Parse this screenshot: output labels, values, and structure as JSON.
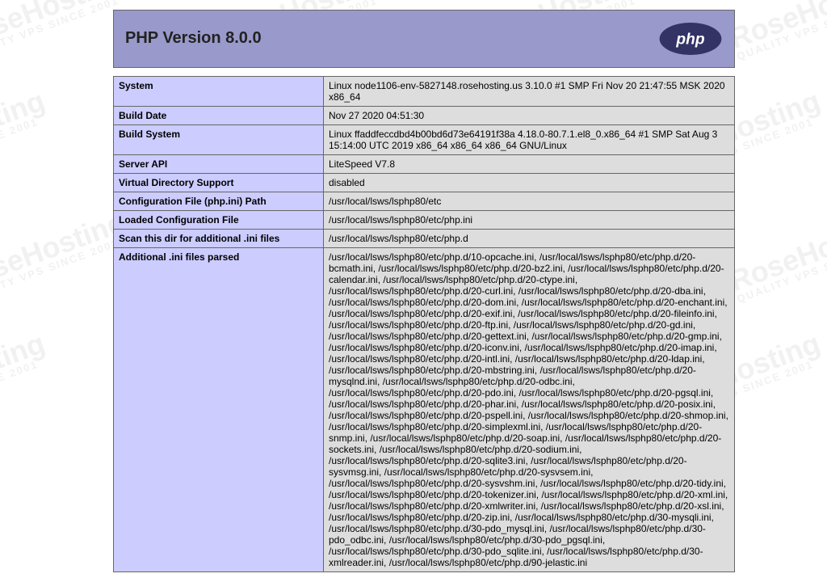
{
  "header": {
    "title": "PHP Version 8.0.0",
    "logo_text": "php"
  },
  "watermark": {
    "brand": "RoseHosting",
    "tagline": "QUALITY VPS SINCE 2001"
  },
  "rows": [
    {
      "label": "System",
      "value": "Linux node1106-env-5827148.rosehosting.us 3.10.0 #1 SMP Fri Nov 20 21:47:55 MSK 2020 x86_64"
    },
    {
      "label": "Build Date",
      "value": "Nov 27 2020 04:51:30"
    },
    {
      "label": "Build System",
      "value": "Linux ffaddfeccdbd4b00bd6d73e64191f38a 4.18.0-80.7.1.el8_0.x86_64 #1 SMP Sat Aug 3 15:14:00 UTC 2019 x86_64 x86_64 x86_64 GNU/Linux"
    },
    {
      "label": "Server API",
      "value": "LiteSpeed V7.8"
    },
    {
      "label": "Virtual Directory Support",
      "value": "disabled"
    },
    {
      "label": "Configuration File (php.ini) Path",
      "value": "/usr/local/lsws/lsphp80/etc"
    },
    {
      "label": "Loaded Configuration File",
      "value": "/usr/local/lsws/lsphp80/etc/php.ini"
    },
    {
      "label": "Scan this dir for additional .ini files",
      "value": "/usr/local/lsws/lsphp80/etc/php.d"
    },
    {
      "label": "Additional .ini files parsed",
      "value": "/usr/local/lsws/lsphp80/etc/php.d/10-opcache.ini, /usr/local/lsws/lsphp80/etc/php.d/20-bcmath.ini, /usr/local/lsws/lsphp80/etc/php.d/20-bz2.ini, /usr/local/lsws/lsphp80/etc/php.d/20-calendar.ini, /usr/local/lsws/lsphp80/etc/php.d/20-ctype.ini, /usr/local/lsws/lsphp80/etc/php.d/20-curl.ini, /usr/local/lsws/lsphp80/etc/php.d/20-dba.ini, /usr/local/lsws/lsphp80/etc/php.d/20-dom.ini, /usr/local/lsws/lsphp80/etc/php.d/20-enchant.ini, /usr/local/lsws/lsphp80/etc/php.d/20-exif.ini, /usr/local/lsws/lsphp80/etc/php.d/20-fileinfo.ini, /usr/local/lsws/lsphp80/etc/php.d/20-ftp.ini, /usr/local/lsws/lsphp80/etc/php.d/20-gd.ini, /usr/local/lsws/lsphp80/etc/php.d/20-gettext.ini, /usr/local/lsws/lsphp80/etc/php.d/20-gmp.ini, /usr/local/lsws/lsphp80/etc/php.d/20-iconv.ini, /usr/local/lsws/lsphp80/etc/php.d/20-imap.ini, /usr/local/lsws/lsphp80/etc/php.d/20-intl.ini, /usr/local/lsws/lsphp80/etc/php.d/20-ldap.ini, /usr/local/lsws/lsphp80/etc/php.d/20-mbstring.ini, /usr/local/lsws/lsphp80/etc/php.d/20-mysqlnd.ini, /usr/local/lsws/lsphp80/etc/php.d/20-odbc.ini, /usr/local/lsws/lsphp80/etc/php.d/20-pdo.ini, /usr/local/lsws/lsphp80/etc/php.d/20-pgsql.ini, /usr/local/lsws/lsphp80/etc/php.d/20-phar.ini, /usr/local/lsws/lsphp80/etc/php.d/20-posix.ini, /usr/local/lsws/lsphp80/etc/php.d/20-pspell.ini, /usr/local/lsws/lsphp80/etc/php.d/20-shmop.ini, /usr/local/lsws/lsphp80/etc/php.d/20-simplexml.ini, /usr/local/lsws/lsphp80/etc/php.d/20-snmp.ini, /usr/local/lsws/lsphp80/etc/php.d/20-soap.ini, /usr/local/lsws/lsphp80/etc/php.d/20-sockets.ini, /usr/local/lsws/lsphp80/etc/php.d/20-sodium.ini, /usr/local/lsws/lsphp80/etc/php.d/20-sqlite3.ini, /usr/local/lsws/lsphp80/etc/php.d/20-sysvmsg.ini, /usr/local/lsws/lsphp80/etc/php.d/20-sysvsem.ini, /usr/local/lsws/lsphp80/etc/php.d/20-sysvshm.ini, /usr/local/lsws/lsphp80/etc/php.d/20-tidy.ini, /usr/local/lsws/lsphp80/etc/php.d/20-tokenizer.ini, /usr/local/lsws/lsphp80/etc/php.d/20-xml.ini, /usr/local/lsws/lsphp80/etc/php.d/20-xmlwriter.ini, /usr/local/lsws/lsphp80/etc/php.d/20-xsl.ini, /usr/local/lsws/lsphp80/etc/php.d/20-zip.ini, /usr/local/lsws/lsphp80/etc/php.d/30-mysqli.ini, /usr/local/lsws/lsphp80/etc/php.d/30-pdo_mysql.ini, /usr/local/lsws/lsphp80/etc/php.d/30-pdo_odbc.ini, /usr/local/lsws/lsphp80/etc/php.d/30-pdo_pgsql.ini, /usr/local/lsws/lsphp80/etc/php.d/30-pdo_sqlite.ini, /usr/local/lsws/lsphp80/etc/php.d/30-xmlreader.ini, /usr/local/lsws/lsphp80/etc/php.d/90-jelastic.ini"
    }
  ]
}
